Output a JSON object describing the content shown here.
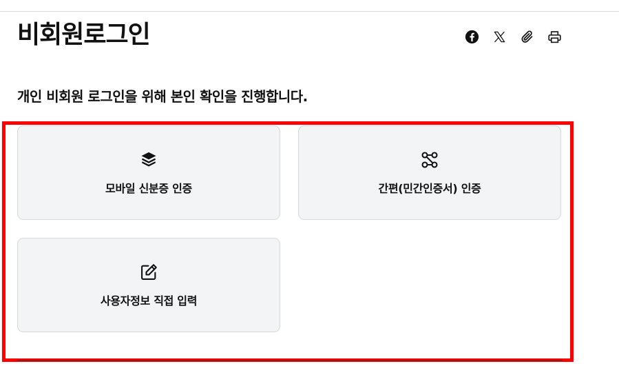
{
  "header": {
    "title": "비회원로그인",
    "share_icons": [
      "facebook-icon",
      "x-icon",
      "link-icon",
      "print-icon"
    ]
  },
  "main": {
    "subtitle": "개인 비회원 로그인을 위해 본인 확인을 진행합니다.",
    "options": [
      {
        "label": "모바일 신분증 인증",
        "icon": "mobile-id-icon"
      },
      {
        "label": "간편(민간인증서) 인증",
        "icon": "simple-auth-icon"
      },
      {
        "label": "사용자정보 직접 입력",
        "icon": "edit-icon"
      }
    ]
  },
  "colors": {
    "highlight": "#ff0000",
    "card_background": "#f3f4f6",
    "card_border": "#d6d8dc",
    "text": "#111111"
  }
}
